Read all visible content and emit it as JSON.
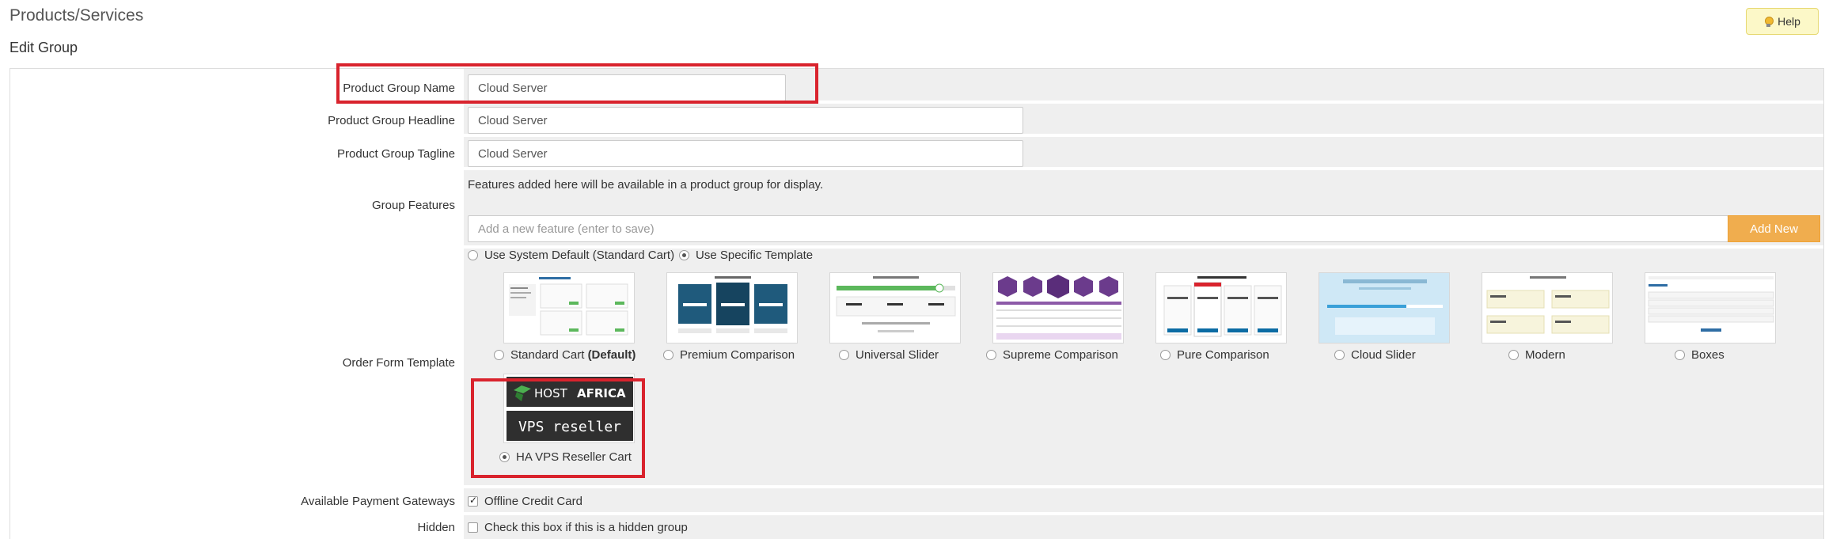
{
  "header": {
    "title": "Products/Services",
    "subtitle": "Edit Group",
    "help_label": "Help"
  },
  "form": {
    "group_name": {
      "label": "Product Group Name",
      "value": "Cloud Server"
    },
    "headline": {
      "label": "Product Group Headline",
      "value": "Cloud Server"
    },
    "tagline": {
      "label": "Product Group Tagline",
      "value": "Cloud Server"
    },
    "features": {
      "label": "Group Features",
      "help_text": "Features added here will be available in a product group for display.",
      "placeholder": "Add a new feature (enter to save)",
      "add_label": "Add New"
    },
    "template": {
      "label": "Order Form Template",
      "use_default": "Use System Default (Standard Cart)",
      "use_specific": "Use Specific Template",
      "options": [
        {
          "name": "Standard Cart",
          "suffix": "(Default)",
          "selected": false
        },
        {
          "name": "Premium Comparison",
          "selected": false
        },
        {
          "name": "Universal Slider",
          "selected": false
        },
        {
          "name": "Supreme Comparison",
          "selected": false
        },
        {
          "name": "Pure Comparison",
          "selected": false
        },
        {
          "name": "Cloud Slider",
          "selected": false
        },
        {
          "name": "Modern",
          "selected": false
        },
        {
          "name": "Boxes",
          "selected": false
        },
        {
          "name": "HA VPS Reseller Cart",
          "selected": true,
          "logo_text_1": "HOST",
          "logo_text_2": "AFRICA",
          "logo_text_3": "VPS reseller"
        }
      ]
    },
    "gateways": {
      "label": "Available Payment Gateways",
      "option": "Offline Credit Card",
      "checked": true
    },
    "hidden": {
      "label": "Hidden",
      "option": "Check this box if this is a hidden group",
      "checked": false
    }
  },
  "colors": {
    "highlight": "#d9232d",
    "button_accent": "#f0ad4e",
    "field_bg": "#efefef"
  }
}
